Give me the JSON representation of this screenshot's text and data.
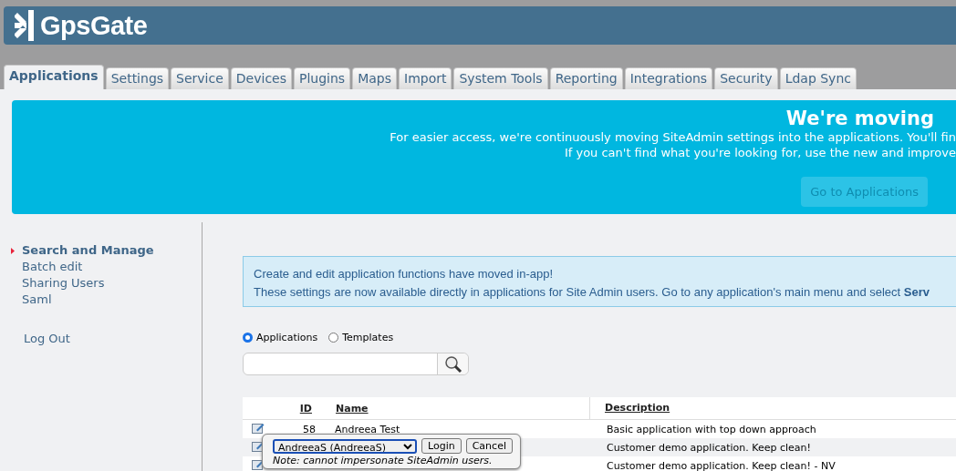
{
  "header": {
    "logo": "GpsGate"
  },
  "tabs": [
    {
      "label": "Applications",
      "selected": true
    },
    {
      "label": "Settings",
      "selected": false
    },
    {
      "label": "Service",
      "selected": false
    },
    {
      "label": "Devices",
      "selected": false
    },
    {
      "label": "Plugins",
      "selected": false
    },
    {
      "label": "Maps",
      "selected": false
    },
    {
      "label": "Import",
      "selected": false
    },
    {
      "label": "System Tools",
      "selected": false
    },
    {
      "label": "Reporting",
      "selected": false
    },
    {
      "label": "Integrations",
      "selected": false
    },
    {
      "label": "Security",
      "selected": false
    },
    {
      "label": "Ldap Sync",
      "selected": false
    }
  ],
  "banner": {
    "title": "We're moving",
    "lines": [
      "For easier access, we're continuously moving SiteAdmin settings into the applications. You'll fin",
      "If you can't find what you're looking for, use the new and improve"
    ],
    "button": "Go to Applications"
  },
  "sidebar": {
    "items": [
      {
        "label": "Search and Manage",
        "selected": true
      },
      {
        "label": "Batch edit",
        "selected": false
      },
      {
        "label": "Sharing Users",
        "selected": false
      },
      {
        "label": "Saml",
        "selected": false
      }
    ],
    "logout": "Log Out"
  },
  "notice": {
    "lines": [
      "Create and edit application functions have moved in-app!",
      "These settings are now available directly in applications for Site Admin users. Go to any application's main menu and select **Serv**"
    ]
  },
  "filter": [
    {
      "label": "Applications",
      "selected": true
    },
    {
      "label": "Templates",
      "selected": false
    }
  ],
  "table": {
    "columns": [
      "ID",
      "Name",
      "Description"
    ],
    "rows": [
      {
        "id": "58",
        "name": "Andreea Test",
        "description": "Basic application with top down approach"
      },
      {
        "description": "Customer demo application. Keep clean!"
      },
      {
        "description": "Customer demo application. Keep clean! - NV"
      }
    ]
  },
  "impersonate": {
    "user": "AndreeaS (AndreeaS)",
    "buttons": [
      "Login",
      "Cancel"
    ],
    "note": "Note: cannot impersonate SiteAdmin users."
  }
}
